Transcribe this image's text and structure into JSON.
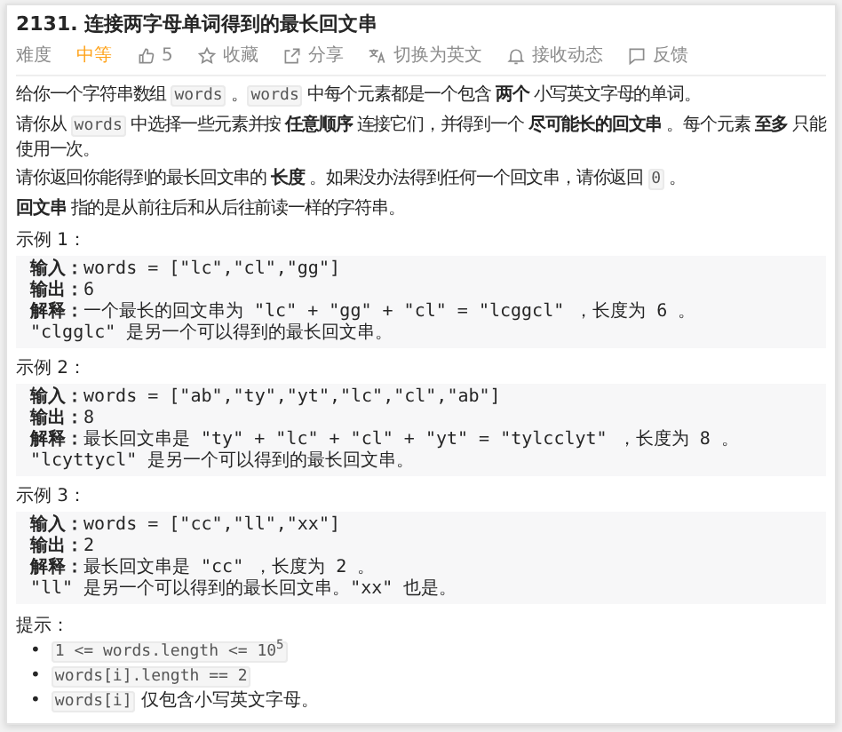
{
  "title": "2131. 连接两字母单词得到的最长回文串",
  "toolbar": {
    "difficulty_label": "难度",
    "difficulty": "中等",
    "items": [
      {
        "kind": "like",
        "label": "5"
      },
      {
        "kind": "star",
        "label": "收藏"
      },
      {
        "kind": "share",
        "label": "分享"
      },
      {
        "kind": "translate",
        "label": "切换为英文"
      },
      {
        "kind": "bell",
        "label": "接收动态"
      },
      {
        "kind": "feedback",
        "label": "反馈"
      }
    ]
  },
  "description": [
    [
      {
        "kind": "text",
        "text": "给你一个字符串数组 "
      },
      {
        "kind": "code",
        "text": "words"
      },
      {
        "kind": "text",
        "text": " 。"
      },
      {
        "kind": "code",
        "text": "words"
      },
      {
        "kind": "text",
        "text": " 中每个元素都是一个包含 **两个** 小写英文字母的单词。"
      }
    ],
    [
      {
        "kind": "text",
        "text": "请你从 "
      },
      {
        "kind": "code",
        "text": "words"
      },
      {
        "kind": "text",
        "text": " 中选择一些元素并按 **任意顺序** 连接它们，并得到一个 **尽可能长的回文串** 。每个元素 **至多** 只能使用一次。"
      }
    ],
    [
      {
        "kind": "text",
        "text": "请你返回你能得到的最长回文串的 **长度** 。如果没办法得到任何一个回文串，请你返回 "
      },
      {
        "kind": "code",
        "text": "0"
      },
      {
        "kind": "text",
        "text": " 。"
      }
    ],
    [
      {
        "kind": "text",
        "text": "**回文串** 指的是从前往后和从后往前读一样的字符串。"
      }
    ]
  ],
  "examples": [
    {
      "heading": "示例 1：",
      "lines": [
        "**输入：**words = [\"lc\",\"cl\",\"gg\"]",
        "**输出：**6",
        "**解释：**一个最长的回文串为 \"lc\" + \"gg\" + \"cl\" = \"lcggcl\" ，长度为 6 。",
        "\"clgglc\" 是另一个可以得到的最长回文串。"
      ]
    },
    {
      "heading": "示例 2：",
      "lines": [
        "**输入：**words = [\"ab\",\"ty\",\"yt\",\"lc\",\"cl\",\"ab\"]",
        "**输出：**8",
        "**解释：**最长回文串是 \"ty\" + \"lc\" + \"cl\" + \"yt\" = \"tylcclyt\" ，长度为 8 。",
        "\"lcyttycl\" 是另一个可以得到的最长回文串。"
      ]
    },
    {
      "heading": "示例 3：",
      "lines": [
        "**输入：**words = [\"cc\",\"ll\",\"xx\"]",
        "**输出：**2",
        "**解释：**最长回文串是 \"cc\" ，长度为 2 。",
        "\"ll\" 是另一个可以得到的最长回文串。\"xx\" 也是。"
      ]
    }
  ],
  "hints": {
    "heading": "提示：",
    "items": [
      {
        "marker": "•",
        "parts": [
          {
            "kind": "code",
            "text": "1 <= words.length <= 10$^{5}$"
          }
        ]
      },
      {
        "marker": "•",
        "parts": [
          {
            "kind": "code",
            "text": "words[i].length == 2"
          }
        ]
      },
      {
        "marker": "•",
        "parts": [
          {
            "kind": "code",
            "text": "words[i]"
          },
          {
            "kind": "text",
            "text": " 仅包含小写英文字母。"
          }
        ]
      }
    ]
  }
}
